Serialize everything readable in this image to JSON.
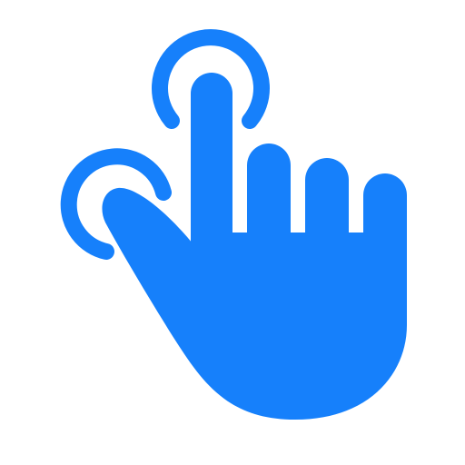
{
  "icon": {
    "name": "hand-tap-gesture-icon",
    "description_visible": false
  },
  "colors": {
    "background": "#ffffff",
    "accent": "#1680fb"
  }
}
